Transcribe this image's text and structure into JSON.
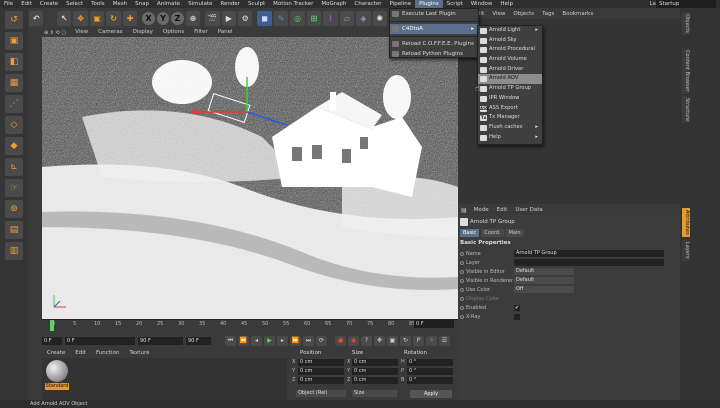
{
  "menubar": {
    "items": [
      "File",
      "Edit",
      "Create",
      "Select",
      "Tools",
      "Mesh",
      "Snap",
      "Animate",
      "Simulate",
      "Render",
      "Sculpt",
      "Motion Tracker",
      "MoGraph",
      "Character",
      "Pipeline",
      "Plugins",
      "Script",
      "Window",
      "Help"
    ],
    "active": "Plugins",
    "layout_label": "Layout:",
    "layout_value": "Startup"
  },
  "toolbar": {
    "axis_x": "X",
    "axis_y": "Y",
    "axis_z": "Z"
  },
  "viewport": {
    "menu": [
      "View",
      "Cameras",
      "Display",
      "Options",
      "Filter",
      "Panel"
    ]
  },
  "timeline": {
    "ticks": [
      "0",
      "5",
      "10",
      "15",
      "20",
      "25",
      "30",
      "35",
      "40",
      "45",
      "50",
      "55",
      "60",
      "65",
      "70",
      "75",
      "80",
      "85",
      "90"
    ],
    "end_frame": "0 F"
  },
  "transport": {
    "start": "0 F",
    "current": "0 F",
    "end": "90 F",
    "max": "90 F"
  },
  "material": {
    "menu": [
      "Create",
      "Edit",
      "Function",
      "Texture"
    ],
    "name": "Standard"
  },
  "coords": {
    "headers": [
      "Position",
      "Size",
      "Rotation"
    ],
    "rows": [
      {
        "axis": "X",
        "pos": "0 cm",
        "size": "0 cm",
        "rot_label": "H",
        "rot": "0 °"
      },
      {
        "axis": "Y",
        "pos": "0 cm",
        "size": "0 cm",
        "rot_label": "P",
        "rot": "0 °"
      },
      {
        "axis": "Z",
        "pos": "0 cm",
        "size": "0 cm",
        "rot_label": "B",
        "rot": "0 °"
      }
    ],
    "mode_left": "Object (Rel)",
    "mode_mid": "Size",
    "apply": "Apply"
  },
  "status": "Add Arnold AOV Object",
  "object_manager": {
    "menu": [
      "Edit",
      "View",
      "Objects",
      "Tags",
      "Bookmarks"
    ]
  },
  "right_tabs": [
    "Objects",
    "Content Browser",
    "Structure",
    "Attributes",
    "Layers"
  ],
  "attributes": {
    "menu": [
      "Mode",
      "Edit",
      "User Data"
    ],
    "title": "Arnold TP Group",
    "tabs": [
      "Basic",
      "Coord.",
      "Main"
    ],
    "active_tab": "Basic",
    "section": "Basic Properties",
    "props": [
      {
        "label": "Name",
        "value": "Arnold TP Group",
        "type": "text"
      },
      {
        "label": "Layer",
        "value": "",
        "type": "text"
      },
      {
        "label": "Visible in Editor",
        "value": "Default",
        "type": "dropdown"
      },
      {
        "label": "Visible in Renderer",
        "value": "Default",
        "type": "dropdown"
      },
      {
        "label": "Use Color",
        "value": "Off",
        "type": "dropdown"
      },
      {
        "label": "Display Color",
        "value": "",
        "type": "disabled"
      },
      {
        "label": "Enabled",
        "value": "✔",
        "type": "check"
      },
      {
        "label": "X-Ray",
        "value": "",
        "type": "check"
      }
    ]
  },
  "plugins_menu": {
    "items": [
      {
        "label": "Execute Last Plugin",
        "arrow": ""
      },
      {
        "label": "C4DtoA",
        "arrow": "▸"
      },
      {
        "label": "Reload C.O.F.F.E.E. Plugins",
        "arrow": ""
      },
      {
        "label": "Reload Python Plugins",
        "arrow": ""
      }
    ],
    "highlighted": "C4DtoA"
  },
  "c4dtoa_menu": {
    "items": [
      {
        "label": "Arnold Light",
        "icon": "",
        "arrow": "▸"
      },
      {
        "label": "Arnold Sky",
        "icon": "",
        "arrow": ""
      },
      {
        "label": "Arnold Procedural",
        "icon": "",
        "arrow": ""
      },
      {
        "label": "Arnold Volume",
        "icon": "",
        "arrow": ""
      },
      {
        "label": "Arnold Driver",
        "icon": "",
        "arrow": ""
      },
      {
        "label": "Arnold AOV",
        "icon": "",
        "arrow": ""
      },
      {
        "label": "Arnold TP Group",
        "icon": "",
        "arrow": ""
      },
      {
        "label": "IPR Window",
        "icon": "",
        "arrow": ""
      },
      {
        "label": "ASS Export",
        "icon": "ASS",
        "arrow": ""
      },
      {
        "label": "Tx Manager",
        "icon": "Tx",
        "arrow": ""
      },
      {
        "label": "Flush caches",
        "icon": "",
        "arrow": "▸"
      },
      {
        "label": "Help",
        "icon": "",
        "arrow": "▸"
      }
    ],
    "highlighted": "Arnold AOV"
  },
  "colors": {
    "accent": "#e39b2f",
    "highlight": "#5b6f8a",
    "menu_bg": "#3f3f3f"
  }
}
